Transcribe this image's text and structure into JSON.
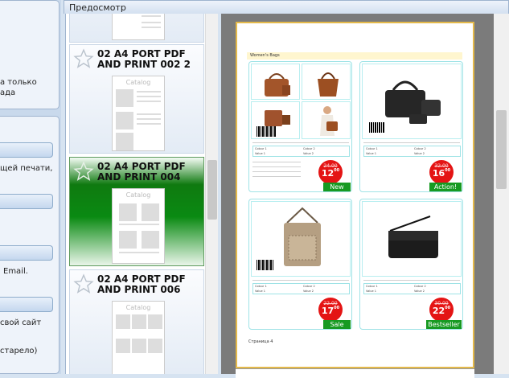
{
  "left": {
    "text_only": "а только",
    "text_da": "ада",
    "text_print": "щей печати,",
    "text_email": "Email.",
    "text_site": "свой сайт",
    "text_old": "старело)"
  },
  "preview_header": {
    "title": "Предосмотр"
  },
  "templates": [
    {
      "name": "02 A4 PORT PDF AND PRINT 002 2",
      "thumb": "Catalog",
      "selected": false
    },
    {
      "name": "02 A4 PORT PDF AND PRINT 004",
      "thumb": "Catalog",
      "selected": true
    },
    {
      "name": "02 A4 PORT PDF AND PRINT 006",
      "thumb": "Catalog",
      "selected": false
    }
  ],
  "page": {
    "section_title": "Women's Bags",
    "footer": "Страница 4",
    "products": [
      {
        "old_price": "24.00",
        "price": "12",
        "cents": "00",
        "badge": "New",
        "col1": "Colour 1",
        "col2": "Colour 2",
        "v1": "Value 1",
        "v2": "Value 2"
      },
      {
        "old_price": "32.00",
        "price": "16",
        "cents": "00",
        "badge": "Action!",
        "col1": "Colour 1",
        "col2": "Colour 2",
        "v1": "Value 1",
        "v2": "Value 2"
      },
      {
        "old_price": "22.00",
        "price": "17",
        "cents": "00",
        "badge": "Sale",
        "col1": "Colour 1",
        "col2": "Colour 2",
        "v1": "Value 1",
        "v2": "Value 2"
      },
      {
        "old_price": "30.00",
        "price": "22",
        "cents": "00",
        "badge": "Bestseller",
        "col1": "Colour 1",
        "col2": "Colour 2",
        "v1": "Value 1",
        "v2": "Value 2"
      }
    ]
  }
}
